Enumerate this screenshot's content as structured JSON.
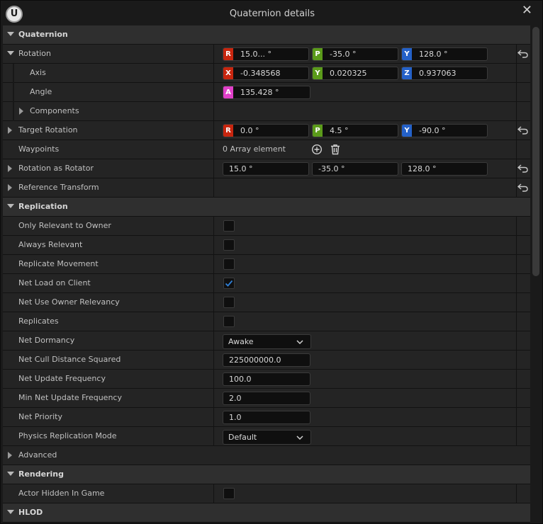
{
  "window": {
    "title": "Quaternion details",
    "logo_letter": "U"
  },
  "quaternion": {
    "header": "Quaternion",
    "rotation": {
      "label": "Rotation",
      "r": "15.0... °",
      "p": "-35.0 °",
      "y": "128.0 °"
    },
    "axis": {
      "label": "Axis",
      "x": "-0.348568",
      "y": "0.020325",
      "z": "0.937063"
    },
    "angle": {
      "label": "Angle",
      "value": "135.428 °"
    },
    "components": {
      "label": "Components"
    },
    "target_rotation": {
      "label": "Target Rotation",
      "r": "0.0 °",
      "p": "4.5 °",
      "y": "-90.0 °"
    },
    "waypoints": {
      "label": "Waypoints",
      "value": "0 Array element"
    },
    "rotation_as_rotator": {
      "label": "Rotation as Rotator",
      "a": "15.0 °",
      "b": "-35.0 °",
      "c": "128.0 °"
    },
    "reference_transform": {
      "label": "Reference Transform"
    }
  },
  "replication": {
    "header": "Replication",
    "only_relevant_to_owner": {
      "label": "Only Relevant to Owner",
      "checked": false
    },
    "always_relevant": {
      "label": "Always Relevant",
      "checked": false
    },
    "replicate_movement": {
      "label": "Replicate Movement",
      "checked": false
    },
    "net_load_on_client": {
      "label": "Net Load on Client",
      "checked": true
    },
    "net_use_owner_relevancy": {
      "label": "Net Use Owner Relevancy",
      "checked": false
    },
    "replicates": {
      "label": "Replicates",
      "checked": false
    },
    "net_dormancy": {
      "label": "Net Dormancy",
      "value": "Awake"
    },
    "net_cull_distance_squared": {
      "label": "Net Cull Distance Squared",
      "value": "225000000.0"
    },
    "net_update_frequency": {
      "label": "Net Update Frequency",
      "value": "100.0"
    },
    "min_net_update_frequency": {
      "label": "Min Net Update Frequency",
      "value": "2.0"
    },
    "net_priority": {
      "label": "Net Priority",
      "value": "1.0"
    },
    "physics_replication_mode": {
      "label": "Physics Replication Mode",
      "value": "Default"
    }
  },
  "advanced": {
    "label": "Advanced"
  },
  "rendering": {
    "header": "Rendering",
    "actor_hidden_in_game": {
      "label": "Actor Hidden In Game",
      "checked": false
    }
  },
  "hlod": {
    "header": "HLOD"
  },
  "badges": {
    "r": "R",
    "p": "P",
    "y": "Y",
    "x": "X",
    "z": "Z",
    "a": "A"
  },
  "colors": {
    "red": "#c8260f",
    "green": "#5b9b1a",
    "blue": "#2461c8",
    "magenta": "#e040c8",
    "check": "#2f7fd6"
  }
}
